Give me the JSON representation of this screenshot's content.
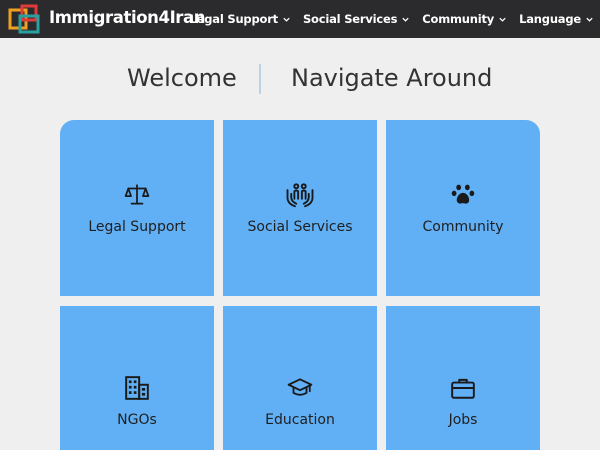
{
  "brand": {
    "name": "Immigration4Iran"
  },
  "nav": {
    "items": [
      {
        "label": "Legal Support",
        "icon": "chevron-down-icon"
      },
      {
        "label": "Social Services",
        "icon": "chevron-down-icon"
      },
      {
        "label": "Community",
        "icon": "chevron-down-icon"
      },
      {
        "label": "Language",
        "icon": "chevron-down-icon"
      }
    ]
  },
  "header": {
    "welcome": "Welcome",
    "navigate": "Navigate Around"
  },
  "tiles": [
    {
      "label": "Legal Support",
      "icon": "scale-icon"
    },
    {
      "label": "Social Services",
      "icon": "people-hands-icon"
    },
    {
      "label": "Community",
      "icon": "paw-icon"
    },
    {
      "label": "NGOs",
      "icon": "building-icon"
    },
    {
      "label": "Education",
      "icon": "graduation-cap-icon"
    },
    {
      "label": "Jobs",
      "icon": "briefcase-icon"
    }
  ],
  "colors": {
    "navbar": "#2b2b2e",
    "tile": "#61b0f6",
    "background": "#efefef",
    "logo_orange": "#f0a020",
    "logo_red": "#e03a3a",
    "logo_teal": "#2aa0a0"
  }
}
